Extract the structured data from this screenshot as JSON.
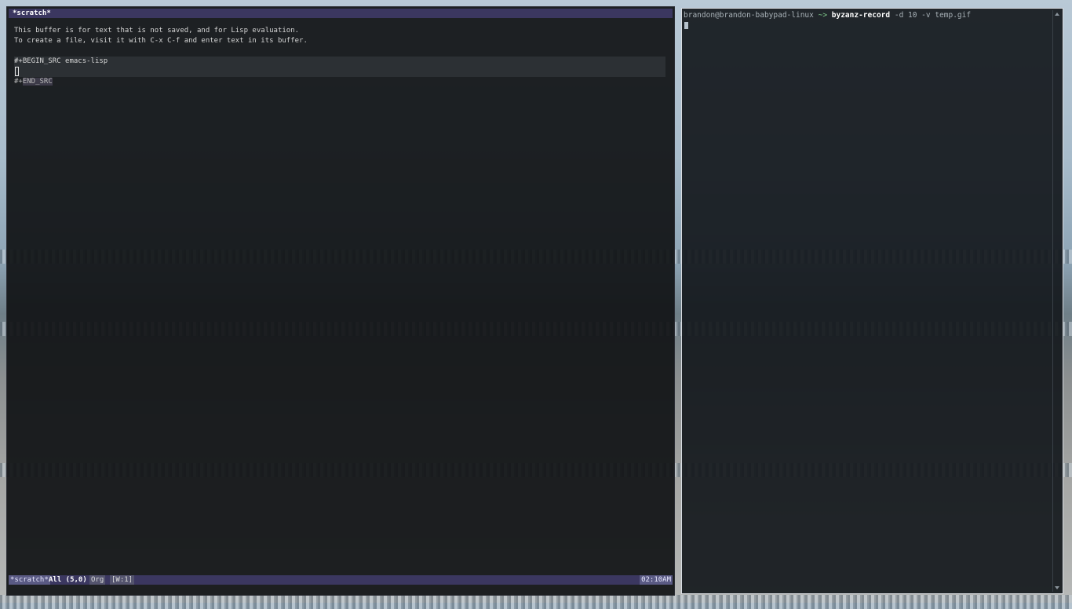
{
  "emacs": {
    "title": "*scratch*",
    "buffer_lines": [
      "This buffer is for text that is not saved, and for Lisp evaluation.",
      "To create a file, visit it with C-x C-f and enter text in its buffer."
    ],
    "src_begin": "#+BEGIN_SRC emacs-lisp",
    "src_end_prefix": "#+",
    "src_end_rest": "END_SRC",
    "modeline": {
      "buffer_name": "*scratch*",
      "position": "All (5,0)",
      "major_mode": "Org",
      "window": "[W:1]",
      "time": "02:10AM"
    }
  },
  "terminal": {
    "prompt": "brandon@brandon-babypad-linux",
    "arrow": " ~> ",
    "command": "byzanz-record",
    "args": " -d 10 -v temp.gif"
  }
}
